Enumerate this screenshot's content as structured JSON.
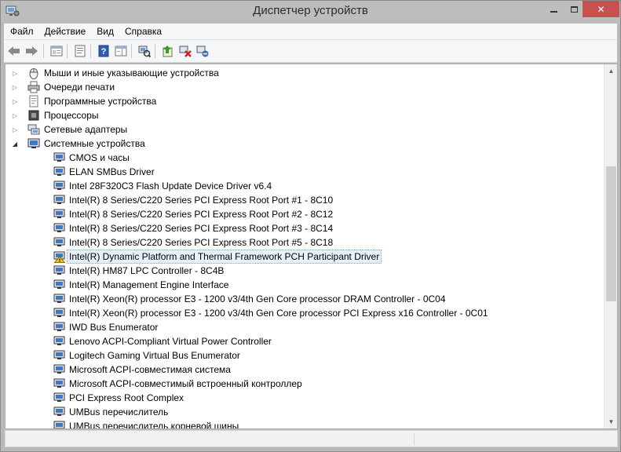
{
  "window": {
    "title": "Диспетчер устройств",
    "close_glyph": "✕"
  },
  "menu": [
    "Файл",
    "Действие",
    "Вид",
    "Справка"
  ],
  "toolbar": [
    {
      "name": "back-button",
      "icon": "arrow-left-icon"
    },
    {
      "name": "forward-button",
      "icon": "arrow-right-icon"
    },
    {
      "name": "show-hide-console-tree-button",
      "icon": "console-tree-icon"
    },
    {
      "name": "properties-button",
      "icon": "properties-icon"
    },
    {
      "name": "help-button",
      "icon": "help-icon"
    },
    {
      "name": "show-hide-action-pane-button",
      "icon": "action-pane-icon"
    },
    {
      "name": "scan-hardware-button",
      "icon": "scan-hardware-icon"
    },
    {
      "name": "update-driver-button",
      "icon": "update-driver-icon"
    },
    {
      "name": "uninstall-button",
      "icon": "uninstall-icon"
    },
    {
      "name": "disable-device-button",
      "icon": "disable-device-icon"
    }
  ],
  "tree": {
    "categories": [
      {
        "label": "Мыши и иные указывающие устройства",
        "icon": "mouse-icon",
        "expanded": false
      },
      {
        "label": "Очереди печати",
        "icon": "printer-icon",
        "expanded": false
      },
      {
        "label": "Программные устройства",
        "icon": "software-device-icon",
        "expanded": false
      },
      {
        "label": "Процессоры",
        "icon": "processor-icon",
        "expanded": false
      },
      {
        "label": "Сетевые адаптеры",
        "icon": "network-adapter-icon",
        "expanded": false
      },
      {
        "label": "Системные устройства",
        "icon": "system-devices-icon",
        "expanded": true
      }
    ],
    "system_devices": [
      {
        "label": "CMOS и часы",
        "warning": false
      },
      {
        "label": "ELAN SMBus Driver",
        "warning": false
      },
      {
        "label": "Intel 28F320C3 Flash Update Device Driver v6.4",
        "warning": false
      },
      {
        "label": "Intel(R) 8 Series/C220 Series PCI Express Root Port #1 - 8C10",
        "warning": false
      },
      {
        "label": "Intel(R) 8 Series/C220 Series PCI Express Root Port #2 - 8C12",
        "warning": false
      },
      {
        "label": "Intel(R) 8 Series/C220 Series PCI Express Root Port #3 - 8C14",
        "warning": false
      },
      {
        "label": "Intel(R) 8 Series/C220 Series PCI Express Root Port #5 - 8C18",
        "warning": false
      },
      {
        "label": "Intel(R) Dynamic Platform and Thermal Framework PCH Participant Driver",
        "warning": true,
        "selected": true
      },
      {
        "label": "Intel(R) HM87 LPC Controller - 8C4B",
        "warning": false
      },
      {
        "label": "Intel(R) Management Engine Interface",
        "warning": false
      },
      {
        "label": "Intel(R) Xeon(R) processor E3 - 1200 v3/4th Gen Core processor DRAM Controller - 0C04",
        "warning": false
      },
      {
        "label": "Intel(R) Xeon(R) processor E3 - 1200 v3/4th Gen Core processor PCI Express x16 Controller - 0C01",
        "warning": false
      },
      {
        "label": "IWD Bus Enumerator",
        "warning": false
      },
      {
        "label": "Lenovo ACPI-Compliant Virtual Power Controller",
        "warning": false
      },
      {
        "label": "Logitech Gaming Virtual Bus Enumerator",
        "warning": false
      },
      {
        "label": "Microsoft ACPI-совместимая система",
        "warning": false
      },
      {
        "label": "Microsoft ACPI-совместимый встроенный контроллер",
        "warning": false
      },
      {
        "label": "PCI Express Root Complex",
        "warning": false
      },
      {
        "label": "UMBus перечислитель",
        "warning": false
      },
      {
        "label": "UMBus перечислитель корневой шины",
        "warning": false
      }
    ]
  },
  "colors": {
    "selection_border": "#7aa7d6",
    "close_button": "#c7514f",
    "warning": "#f2c21b"
  }
}
